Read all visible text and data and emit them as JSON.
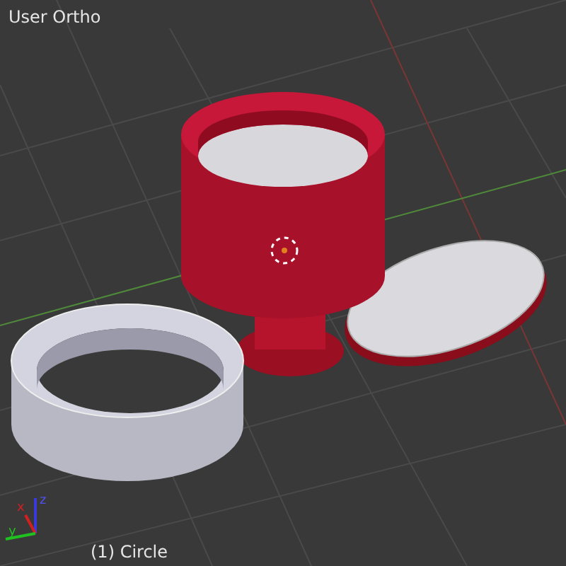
{
  "viewport": {
    "view_label": "User Ortho",
    "object_label": "(1) Circle",
    "axis_gizmo": {
      "x_label": "x",
      "y_label": "y",
      "z_label": "z"
    }
  }
}
